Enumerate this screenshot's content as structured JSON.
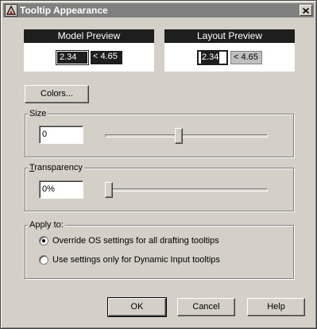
{
  "window": {
    "title": "Tooltip Appearance"
  },
  "model_preview": {
    "header": "Model Preview",
    "value": "2.34",
    "delta": "< 4.65"
  },
  "layout_preview": {
    "header": "Layout Preview",
    "value": "2.34",
    "delta": "< 4.65"
  },
  "colors_button": {
    "label": "Colors..."
  },
  "size": {
    "label": "Size",
    "value": "0",
    "slider_fraction": 0.45
  },
  "transparency": {
    "label": "Transparency",
    "value": "0%",
    "slider_fraction": 0.0
  },
  "apply_to": {
    "label": "Apply to:",
    "options": [
      {
        "label": "Override OS settings for all drafting tooltips",
        "selected": true
      },
      {
        "label": "Use settings only for Dynamic Input tooltips",
        "selected": false
      }
    ]
  },
  "footer": {
    "ok_label": "OK",
    "cancel_label": "Cancel",
    "help_label": "Help"
  },
  "colors": {
    "titlebar": "#808080",
    "preview_header": "#1e1e1e",
    "model_dark": "#1e1e1e",
    "layout_gray": "#c0c0c0"
  }
}
